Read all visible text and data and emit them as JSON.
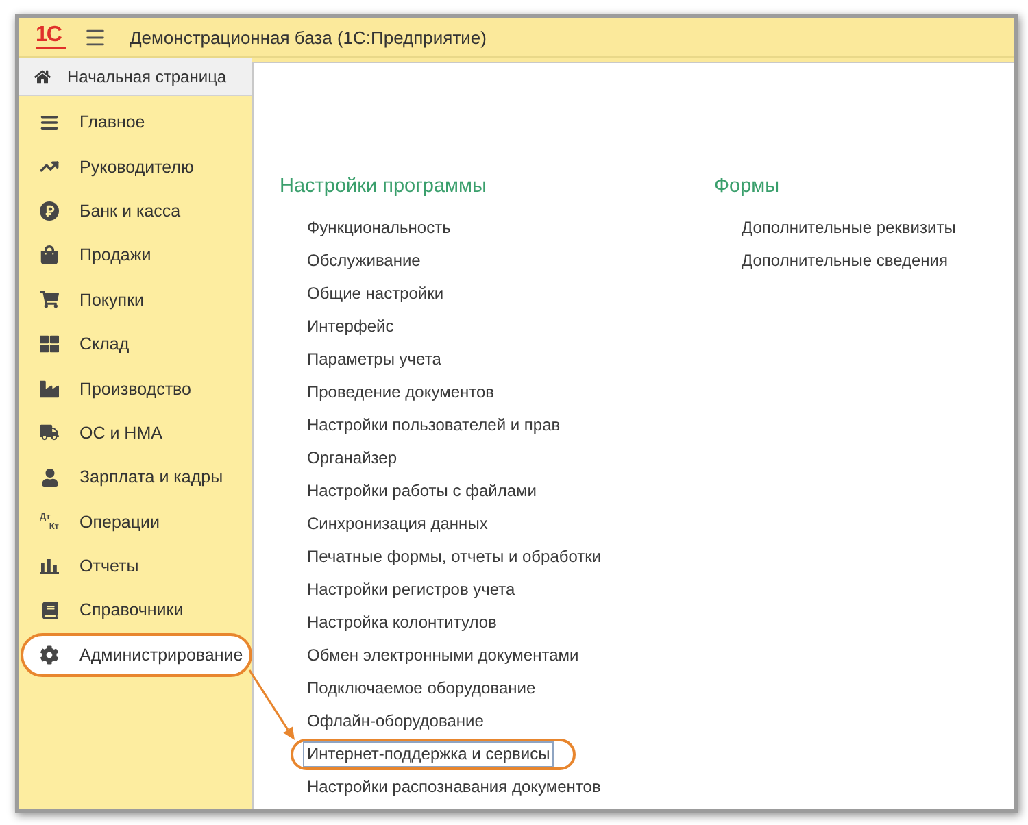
{
  "window": {
    "logo": "1С",
    "title": "Демонстрационная база (1С:Предприятие)"
  },
  "home_tab": {
    "label": "Начальная страница"
  },
  "sidebar": {
    "items": [
      {
        "label": "Главное",
        "selected": false,
        "highlighted": false
      },
      {
        "label": "Руководителю",
        "selected": false,
        "highlighted": false
      },
      {
        "label": "Банк и касса",
        "selected": false,
        "highlighted": false
      },
      {
        "label": "Продажи",
        "selected": false,
        "highlighted": false
      },
      {
        "label": "Покупки",
        "selected": false,
        "highlighted": false
      },
      {
        "label": "Склад",
        "selected": false,
        "highlighted": false
      },
      {
        "label": "Производство",
        "selected": false,
        "highlighted": false
      },
      {
        "label": "ОС и НМА",
        "selected": false,
        "highlighted": false
      },
      {
        "label": "Зарплата и кадры",
        "selected": false,
        "highlighted": false
      },
      {
        "label": "Операции",
        "icon_text": [
          "Дт",
          "Кт"
        ],
        "selected": false,
        "highlighted": false
      },
      {
        "label": "Отчеты",
        "selected": false,
        "highlighted": false
      },
      {
        "label": "Справочники",
        "selected": false,
        "highlighted": false
      },
      {
        "label": "Администрирование",
        "selected": true,
        "highlighted": true
      }
    ]
  },
  "sections": [
    {
      "title": "Настройки программы",
      "items": [
        {
          "label": "Функциональность",
          "focused": false,
          "highlighted": false
        },
        {
          "label": "Обслуживание",
          "focused": false,
          "highlighted": false
        },
        {
          "label": "Общие настройки",
          "focused": false,
          "highlighted": false
        },
        {
          "label": "Интерфейс",
          "focused": false,
          "highlighted": false
        },
        {
          "label": "Параметры учета",
          "focused": false,
          "highlighted": false
        },
        {
          "label": "Проведение документов",
          "focused": false,
          "highlighted": false
        },
        {
          "label": "Настройки пользователей и прав",
          "focused": false,
          "highlighted": false
        },
        {
          "label": "Органайзер",
          "focused": false,
          "highlighted": false
        },
        {
          "label": "Настройки работы с файлами",
          "focused": false,
          "highlighted": false
        },
        {
          "label": "Синхронизация данных",
          "focused": false,
          "highlighted": false
        },
        {
          "label": "Печатные формы, отчеты и обработки",
          "focused": false,
          "highlighted": false
        },
        {
          "label": "Настройки регистров учета",
          "focused": false,
          "highlighted": false
        },
        {
          "label": "Настройка колонтитулов",
          "focused": false,
          "highlighted": false
        },
        {
          "label": "Обмен электронными документами",
          "focused": false,
          "highlighted": false
        },
        {
          "label": "Подключаемое оборудование",
          "focused": false,
          "highlighted": false
        },
        {
          "label": "Офлайн-оборудование",
          "focused": false,
          "highlighted": false
        },
        {
          "label": "Интернет-поддержка и сервисы",
          "focused": true,
          "highlighted": true
        },
        {
          "label": "Настройки распознавания документов",
          "focused": false,
          "highlighted": false
        }
      ]
    },
    {
      "title": "Формы",
      "items": [
        {
          "label": "Дополнительные реквизиты",
          "focused": false,
          "highlighted": false
        },
        {
          "label": "Дополнительные сведения",
          "focused": false,
          "highlighted": false
        }
      ]
    }
  ]
}
